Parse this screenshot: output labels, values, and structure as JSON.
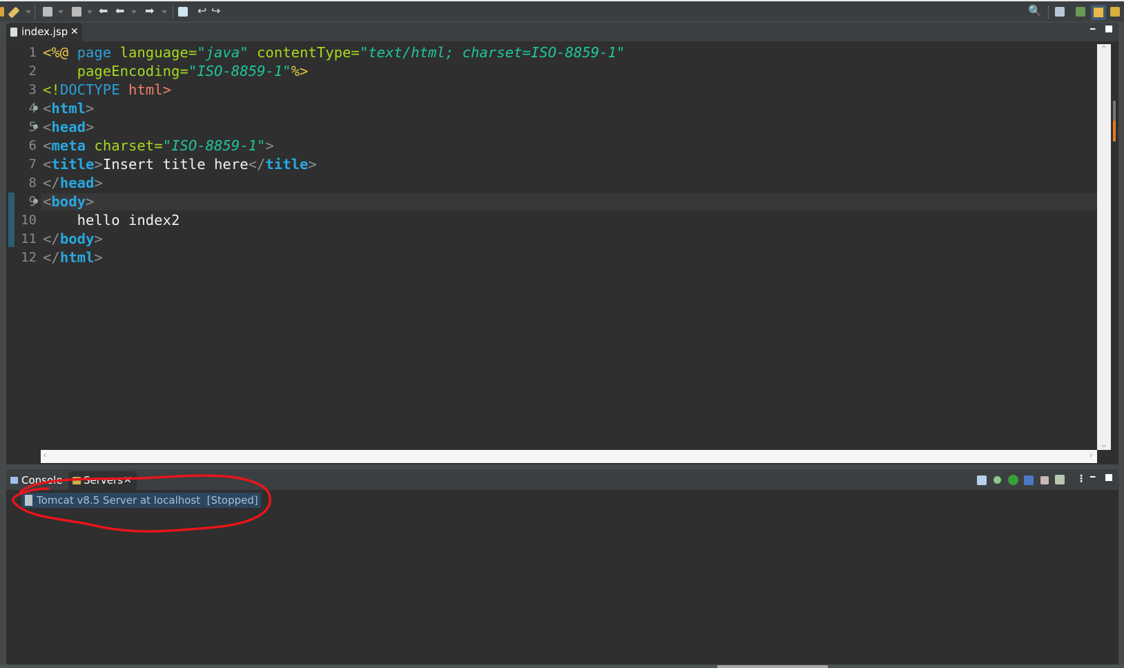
{
  "toolbar": {
    "icons": [
      "new-wizard-icon",
      "brush-icon",
      "external-tools-icon",
      "annotation-icon",
      "back-icon",
      "prev-edit-icon",
      "forward-icon",
      "open-task-icon",
      "undo-icon",
      "redo-icon"
    ],
    "right_icons": [
      "search-icon",
      "open-perspective-icon",
      "java-ee-perspective-icon",
      "resource-perspective-icon",
      "debug-perspective-icon"
    ]
  },
  "editor": {
    "tab_label": "index.jsp",
    "line_numbers": [
      "1",
      "2",
      "3",
      "4",
      "5",
      "6",
      "7",
      "8",
      "9",
      "10",
      "11",
      "12"
    ],
    "folded_lines": [
      4,
      5,
      9
    ],
    "current_line": 9,
    "changed_lines": [
      9,
      10,
      11
    ],
    "lines": [
      [
        [
          "<%@ ",
          "jsp"
        ],
        [
          "page ",
          "dir"
        ],
        [
          "language",
          "attr"
        ],
        [
          "=",
          "attr"
        ],
        [
          "\"java\"",
          "val"
        ],
        [
          " contentType",
          "attr"
        ],
        [
          "=",
          "attr"
        ],
        [
          "\"text/html; charset=ISO-8859-1\"",
          "val"
        ]
      ],
      [
        [
          "    pageEncoding",
          "attr"
        ],
        [
          "=",
          "attr"
        ],
        [
          "\"ISO-8859-1\"",
          "val"
        ],
        [
          "%>",
          "jsp"
        ]
      ],
      [
        [
          "<!",
          "dl"
        ],
        [
          "DOCTYPE",
          "doc"
        ],
        [
          " html>",
          "dn"
        ]
      ],
      [
        [
          "<",
          "br"
        ],
        [
          "html",
          "tag"
        ],
        [
          ">",
          "br"
        ]
      ],
      [
        [
          "<",
          "br"
        ],
        [
          "head",
          "tag"
        ],
        [
          ">",
          "br"
        ]
      ],
      [
        [
          "<",
          "br"
        ],
        [
          "meta",
          "tag"
        ],
        [
          " charset",
          "attr"
        ],
        [
          "=",
          "attr"
        ],
        [
          "\"ISO-8859-1\"",
          "val"
        ],
        [
          ">",
          "br"
        ]
      ],
      [
        [
          "<",
          "br"
        ],
        [
          "title",
          "tag"
        ],
        [
          ">",
          "br"
        ],
        [
          "Insert title here",
          "txt"
        ],
        [
          "</",
          "br"
        ],
        [
          "title",
          "tag"
        ],
        [
          ">",
          "br"
        ]
      ],
      [
        [
          "</",
          "br"
        ],
        [
          "head",
          "tag"
        ],
        [
          ">",
          "br"
        ]
      ],
      [
        [
          "<",
          "br"
        ],
        [
          "body",
          "tag"
        ],
        [
          ">",
          "br"
        ]
      ],
      [
        [
          "    hello index2",
          "txt"
        ]
      ],
      [
        [
          "</",
          "br"
        ],
        [
          "body",
          "tag"
        ],
        [
          ">",
          "br"
        ]
      ],
      [
        [
          "</",
          "br"
        ],
        [
          "html",
          "tag"
        ],
        [
          ">",
          "br"
        ]
      ]
    ]
  },
  "bottom_panel": {
    "tabs": [
      {
        "label": "Console",
        "active": false
      },
      {
        "label": "Servers",
        "active": true
      }
    ],
    "servers": [
      {
        "name": "Tomcat v8.5 Server at localhost",
        "status": "[Stopped]"
      }
    ],
    "toolbar_icons": [
      "collapse-all-icon",
      "debug-server-icon",
      "start-server-icon",
      "profile-server-icon",
      "stop-server-icon",
      "publish-icon",
      "view-menu-icon",
      "minimize-icon",
      "maximize-icon"
    ]
  },
  "colors": {
    "annotation": "#e8151b",
    "background": "#2f2f2f",
    "selection": "#2c4660"
  }
}
